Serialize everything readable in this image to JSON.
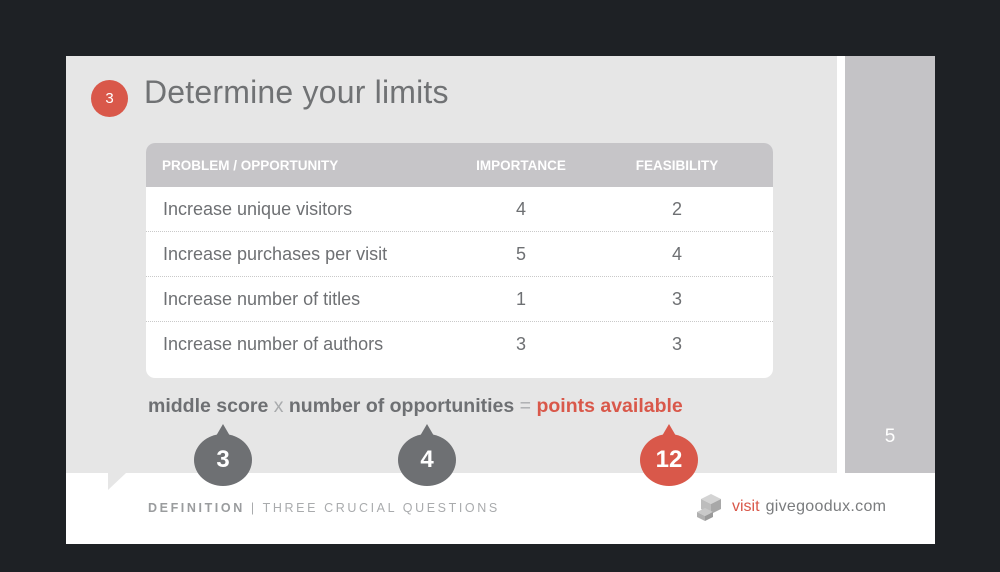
{
  "slide": {
    "step_number": "3",
    "title": "Determine your limits",
    "page_number": "5"
  },
  "table": {
    "headers": [
      "PROBLEM / OPPORTUNITY",
      "IMPORTANCE",
      "FEASIBILITY"
    ],
    "rows": [
      {
        "problem": "Increase unique visitors",
        "importance": "4",
        "feasibility": "2"
      },
      {
        "problem": "Increase purchases per visit",
        "importance": "5",
        "feasibility": "4"
      },
      {
        "problem": "Increase number of titles",
        "importance": "1",
        "feasibility": "3"
      },
      {
        "problem": "Increase number of authors",
        "importance": "3",
        "feasibility": "3"
      }
    ]
  },
  "formula": {
    "term1": "middle score",
    "op1": "x",
    "term2": "number of opportunities",
    "op2": "=",
    "result": "points available",
    "values": {
      "term1": "3",
      "term2": "4",
      "result": "12"
    }
  },
  "footer": {
    "section": "DEFINITION",
    "separator": "|",
    "subtitle": "THREE CRUCIAL QUESTIONS",
    "visit": "visit",
    "domain": "givegoodux.com"
  },
  "colors": {
    "accent": "#d9584a",
    "text_grey": "#6e7073",
    "panel": "#e6e6e6",
    "header_grey": "#c6c5c8",
    "background": "#1e2125"
  },
  "icons": [
    "cube-logo-icon"
  ]
}
